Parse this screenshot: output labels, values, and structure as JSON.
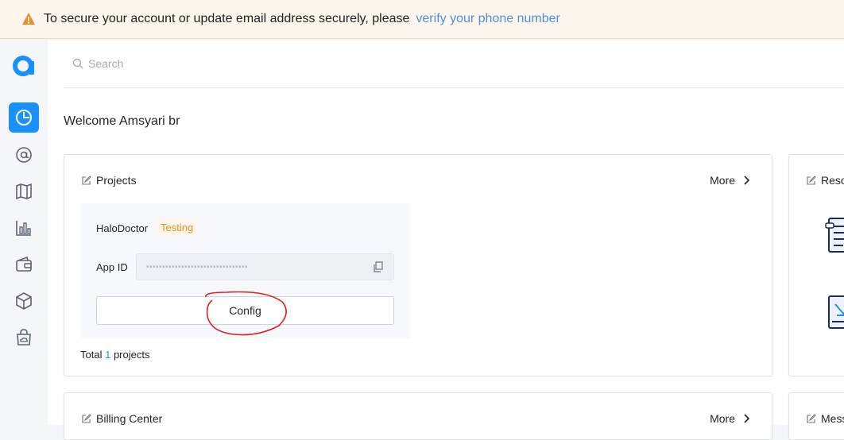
{
  "banner": {
    "message": "To secure your account or update email address securely, please",
    "link": "verify your phone number"
  },
  "sidebar": {
    "items": [
      {
        "icon": "dashboard-icon",
        "active": true
      },
      {
        "icon": "at-sign-icon",
        "active": false
      },
      {
        "icon": "map-icon",
        "active": false
      },
      {
        "icon": "bar-chart-icon",
        "active": false
      },
      {
        "icon": "wallet-icon",
        "active": false
      },
      {
        "icon": "box-icon",
        "active": false
      },
      {
        "icon": "cloud-bag-icon",
        "active": false
      }
    ]
  },
  "search": {
    "placeholder": "Search"
  },
  "welcome": "Welcome Amsyari br",
  "projects": {
    "title": "Projects",
    "more": "More",
    "project_name": "HaloDoctor",
    "status": "Testing",
    "app_id_label": "App ID",
    "app_id_value": "••••••••••••••••••••••••••••••••",
    "config_label": "Config",
    "total_prefix": "Total",
    "total_count": "1",
    "total_suffix": "projects"
  },
  "resources": {
    "title": "Reso"
  },
  "billing": {
    "title": "Billing Center",
    "more": "More"
  },
  "messages": {
    "title": "Mess"
  },
  "colors": {
    "accent": "#1890ff",
    "warning": "#f08a24",
    "link": "#4a90e2"
  }
}
